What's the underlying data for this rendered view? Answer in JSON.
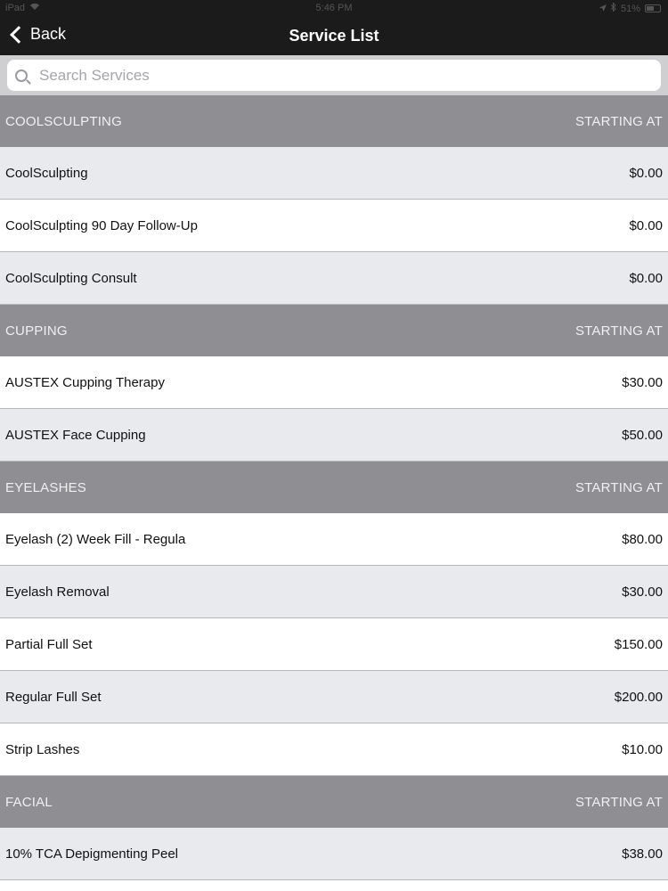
{
  "status_bar": {
    "device": "iPad",
    "time": "5:46 PM",
    "battery_percent": "51%"
  },
  "nav": {
    "back_label": "Back",
    "title": "Service List"
  },
  "search": {
    "placeholder": "Search Services"
  },
  "sections": [
    {
      "name": "COOLSCULPTING",
      "price_header": "STARTING AT",
      "items": [
        {
          "name": "CoolSculpting",
          "price": "$0.00"
        },
        {
          "name": "CoolSculpting 90 Day Follow-Up",
          "price": "$0.00"
        },
        {
          "name": "CoolSculpting Consult",
          "price": "$0.00"
        }
      ]
    },
    {
      "name": "CUPPING",
      "price_header": "STARTING AT",
      "items": [
        {
          "name": "AUSTEX Cupping Therapy",
          "price": "$30.00"
        },
        {
          "name": "AUSTEX Face Cupping",
          "price": "$50.00"
        }
      ]
    },
    {
      "name": "EYELASHES",
      "price_header": "STARTING AT",
      "items": [
        {
          "name": "Eyelash (2) Week Fill - Regula",
          "price": "$80.00"
        },
        {
          "name": "Eyelash Removal",
          "price": "$30.00"
        },
        {
          "name": "Partial Full Set",
          "price": "$150.00"
        },
        {
          "name": "Regular Full Set",
          "price": "$200.00"
        },
        {
          "name": "Strip Lashes",
          "price": "$10.00"
        }
      ]
    },
    {
      "name": "FACIAL",
      "price_header": "STARTING AT",
      "items": [
        {
          "name": "10% TCA Depigmenting Peel",
          "price": "$38.00"
        }
      ]
    }
  ],
  "icons": {
    "wifi": "wifi-icon",
    "location": "location-icon",
    "bluetooth": "bluetooth-icon",
    "battery": "battery-icon",
    "back": "chevron-left-icon",
    "search": "search-icon"
  },
  "colors": {
    "nav_background": "#1c1b1b",
    "section_header": "#8f8f93",
    "row_alt": "#e9eaee",
    "row_plain": "#ffffff",
    "search_background": "#cfcfd2"
  }
}
